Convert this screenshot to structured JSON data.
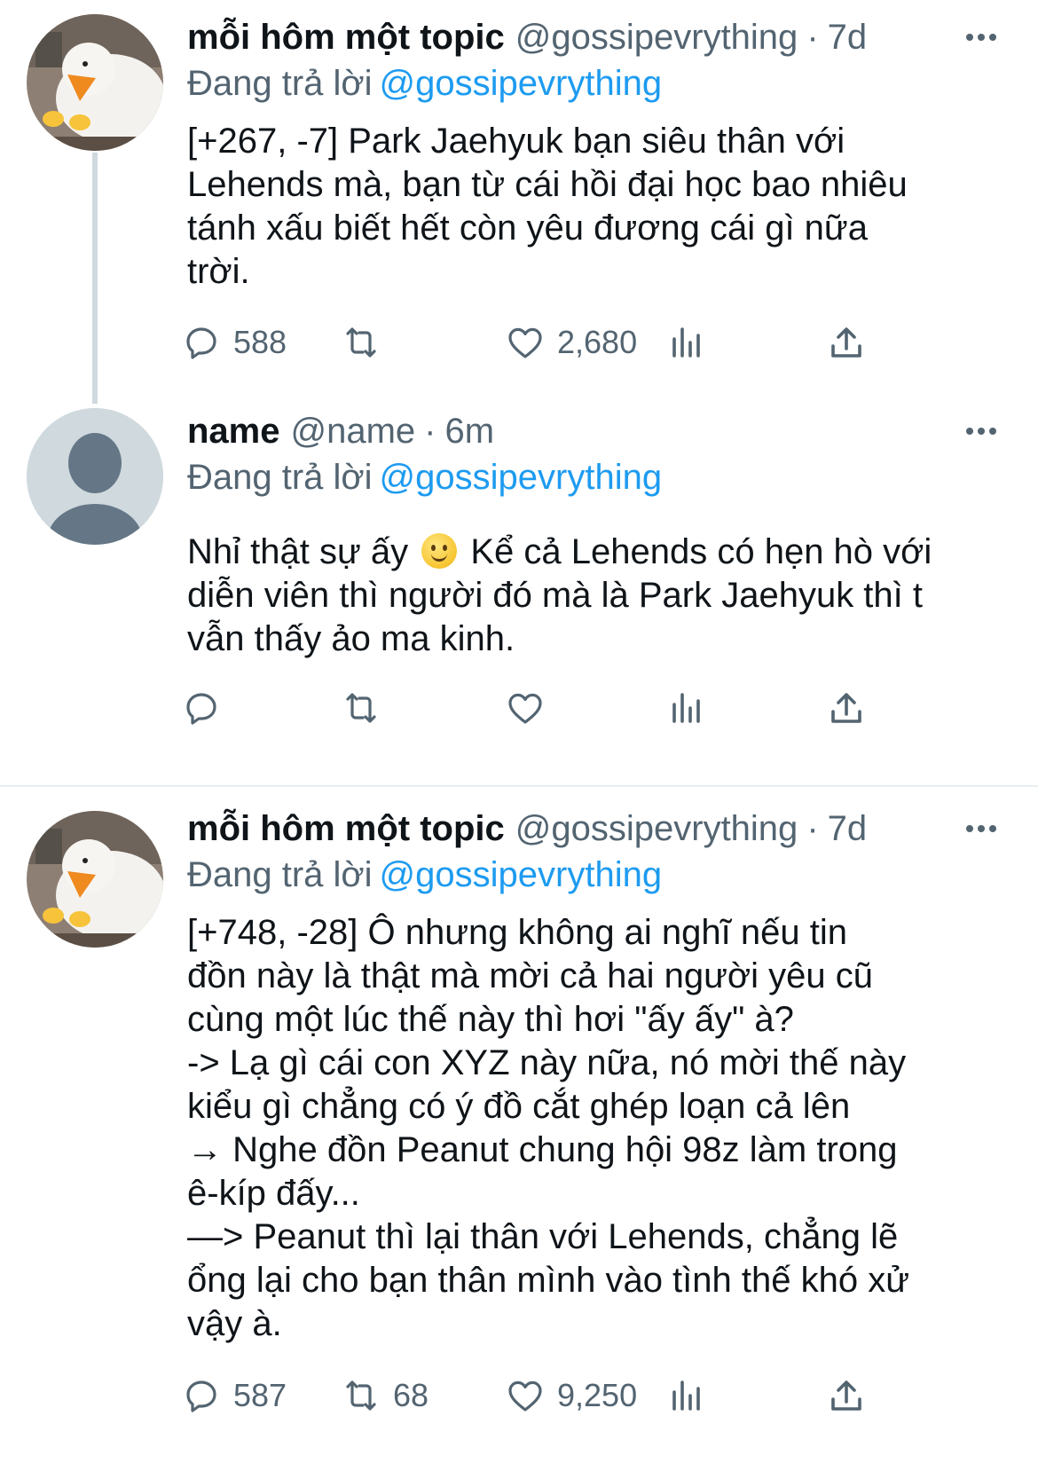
{
  "tweets": [
    {
      "author": "mỗi hôm một topic",
      "handle": "@gossipevrything",
      "time": "7d",
      "avatar_icon": "duck-avatar-icon",
      "replying_label": "Đang trả lời",
      "replying_to": "@gossipevrything",
      "text": "[+267, -7] Park Jaehyuk bạn siêu thân với\nLehends mà, bạn từ cái hồi đại học bao nhiêu\ntánh xấu biết hết còn yêu đương cái gì nữa\ntrời.",
      "replies": "588",
      "retweets": "",
      "likes": "2,680"
    },
    {
      "author": "name",
      "handle": "@name",
      "time": "6m",
      "avatar_icon": "default-user-avatar-icon",
      "replying_label": "Đang trả lời",
      "replying_to": "@gossipevrything",
      "text_before_emoji": "Nhỉ thật sự ấy",
      "emoji": "slightly-smiling-face-emoji",
      "text_after_emoji": " Kể cả Lehends có hẹn hò với\ndiễn viên thì người đó mà là Park Jaehyuk thì t\nvẫn thấy ảo ma kinh.",
      "replies": "",
      "retweets": "",
      "likes": ""
    },
    {
      "author": "mỗi hôm một topic",
      "handle": "@gossipevrything",
      "time": "7d",
      "avatar_icon": "duck-avatar-icon",
      "replying_label": "Đang trả lời",
      "replying_to": "@gossipevrything",
      "text": "[+748, -28] Ô nhưng không ai nghĩ nếu tin\nđồn này là thật mà mời cả hai người yêu cũ\ncùng một lúc thế này thì hơi \"ấy ấy\" à?\n-> Lạ gì cái con XYZ này nữa, nó mời thế này\nkiểu gì chẳng có ý đồ cắt ghép loạn cả lên\n→ Nghe đồn Peanut chung hội 98z làm trong\nê-kíp đấy...\n—> Peanut thì lại thân với Lehends, chẳng lẽ\nổng lại cho bạn thân mình vào tình thế khó xử\nvậy à.",
      "replies": "587",
      "retweets": "68",
      "likes": "9,250"
    }
  ],
  "icons": {
    "reply": "reply-icon",
    "retweet": "retweet-icon",
    "like": "heart-icon",
    "views": "views-icon",
    "share": "share-icon",
    "more": "more-options-icon"
  },
  "colors": {
    "link": "#1d9bf0",
    "secondary_text": "#536471",
    "thread_line": "#cfd9de",
    "default_avatar_bg": "#cfd9de",
    "default_avatar_fg": "#657786"
  }
}
